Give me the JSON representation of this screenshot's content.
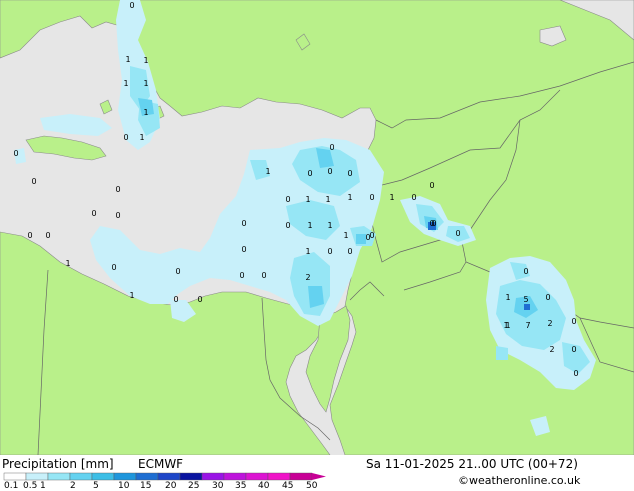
{
  "map": {
    "colors": {
      "land": "#b9f08a",
      "sea": "#e6e6e6",
      "border": "#666666",
      "coast": "#8a8a8a"
    },
    "precip_values": [
      "0",
      "1",
      "1",
      "1",
      "1",
      "1",
      "0",
      "0",
      "0",
      "0",
      "1",
      "1",
      "0",
      "0",
      "0",
      "0",
      "0",
      "1",
      "1",
      "1",
      "0",
      "1",
      "0",
      "0",
      "0",
      "0",
      "0",
      "0",
      "0",
      "0",
      "0",
      "0",
      "0",
      "1",
      "1",
      "1",
      "0",
      "0",
      "0",
      "0",
      "2",
      "5",
      "0",
      "2",
      "1",
      "1",
      "0",
      "0",
      "0",
      "1",
      "1",
      "0",
      "0",
      "1",
      "7",
      "2",
      "0",
      "0",
      "0",
      "0",
      "1",
      "0",
      "0"
    ]
  },
  "footer": {
    "title": "Precipitation [mm]",
    "model": "ECMWF",
    "datetime": "Sa 11-01-2025 21..00 UTC (00+72)",
    "credit": "©weatheronline.co.uk",
    "colorbar": {
      "ticks": [
        "0.1",
        "0.5",
        "1",
        "2",
        "5",
        "10",
        "15",
        "20",
        "25",
        "30",
        "35",
        "40",
        "45",
        "50"
      ],
      "colors": [
        "#fefefe",
        "#c8f0fa",
        "#96e6f5",
        "#64d2f0",
        "#3cbee6",
        "#1e96dc",
        "#1e6ed2",
        "#1e46c8",
        "#0a14a0",
        "#9a14e6",
        "#be14dc",
        "#dc14d2",
        "#f014c8",
        "#c80096"
      ]
    }
  }
}
